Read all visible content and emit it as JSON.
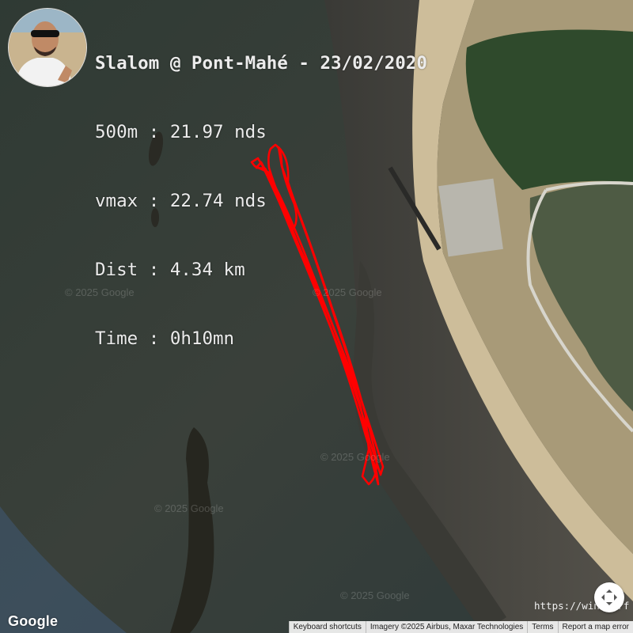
{
  "stats": {
    "title": "Slalom @ Pont-Mahé - 23/02/2020",
    "line_500m": "500m : 21.97 nds",
    "line_vmax": "vmax : 22.74 nds",
    "line_dist": "Dist : 4.34 km",
    "line_time": "Time : 0h10mn"
  },
  "map": {
    "watermark": "© 2025 Google",
    "brand": "Google",
    "url_text": "https://windsurf",
    "track_color": "#ff0000"
  },
  "attribution": {
    "keyboard_shortcuts": "Keyboard shortcuts",
    "imagery": "Imagery ©2025 Airbus, Maxar Technologies",
    "terms": "Terms",
    "report": "Report a map error"
  },
  "icons": {
    "avatar": "avatar-photo",
    "nav": "fullscreen-arrows-icon"
  }
}
